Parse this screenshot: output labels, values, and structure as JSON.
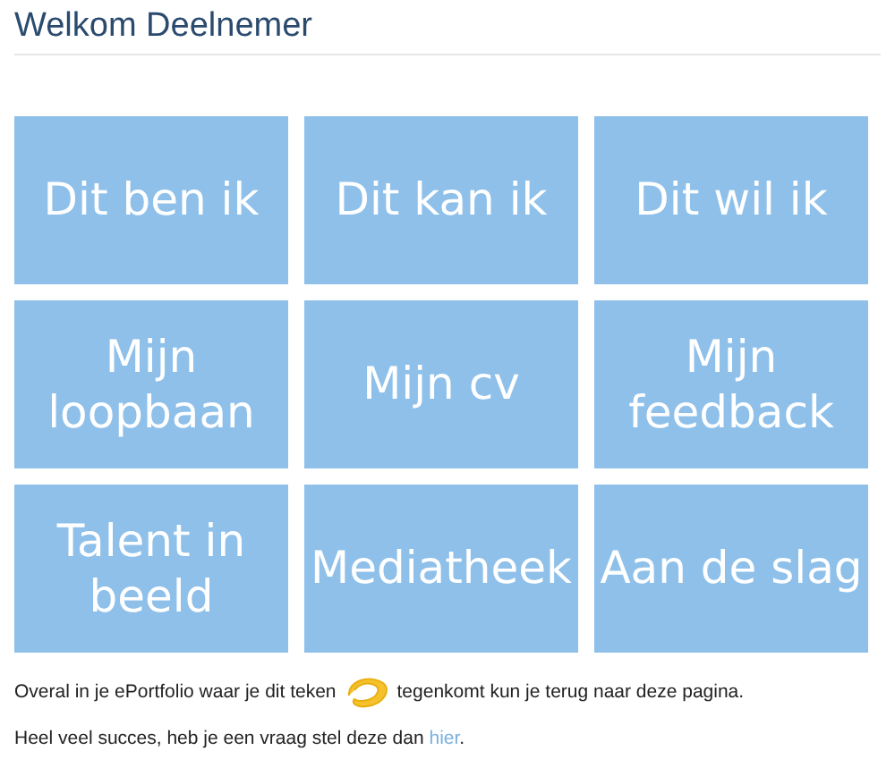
{
  "title": "Welkom Deelnemer",
  "tiles": [
    {
      "label": "Dit ben ik"
    },
    {
      "label": "Dit kan ik"
    },
    {
      "label": "Dit wil ik"
    },
    {
      "label": "Mijn loopbaan"
    },
    {
      "label": "Mijn cv"
    },
    {
      "label": "Mijn feedback"
    },
    {
      "label": "Talent in beeld"
    },
    {
      "label": "Mediatheek"
    },
    {
      "label": "Aan de slag"
    }
  ],
  "notice": {
    "before": "Overal in je ePortfolio waar je dit teken",
    "after": "tegenkomt kun je terug naar deze pagina."
  },
  "help": {
    "text": "Heel veel succes, heb je een vraag stel deze dan",
    "link": "hier",
    "end": "."
  }
}
